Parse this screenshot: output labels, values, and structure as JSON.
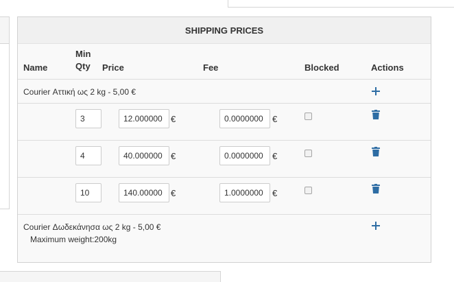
{
  "panel": {
    "title": "SHIPPING PRICES",
    "columns": {
      "name": "Name",
      "min_qty_line1": "Min",
      "min_qty_line2": "Qty",
      "price": "Price",
      "fee": "Fee",
      "blocked": "Blocked",
      "actions": "Actions"
    },
    "groups": [
      {
        "name": "Courier Αττική ως 2 kg - 5,00 €",
        "tiers": [
          {
            "min_qty": "3",
            "price": "12.000000",
            "fee": "0.0000000",
            "currency": "€",
            "blocked": false
          },
          {
            "min_qty": "4",
            "price": "40.000000",
            "fee": "0.0000000",
            "currency": "€",
            "blocked": false
          },
          {
            "min_qty": "10",
            "price": "140.00000",
            "fee": "1.0000000",
            "currency": "€",
            "blocked": false
          }
        ]
      },
      {
        "name": "Courier Δωδεκάνησα ως 2 kg - 5,00 €",
        "subtitle": "Maximum weight:200kg",
        "tiers": []
      }
    ],
    "icons": {
      "add": "plus-icon",
      "delete": "trash-icon"
    },
    "colors": {
      "accent": "#2e6da4",
      "heading_bg": "#f0f0f0",
      "body_bg": "#f9f9f9",
      "border": "#dcdcdc"
    }
  }
}
